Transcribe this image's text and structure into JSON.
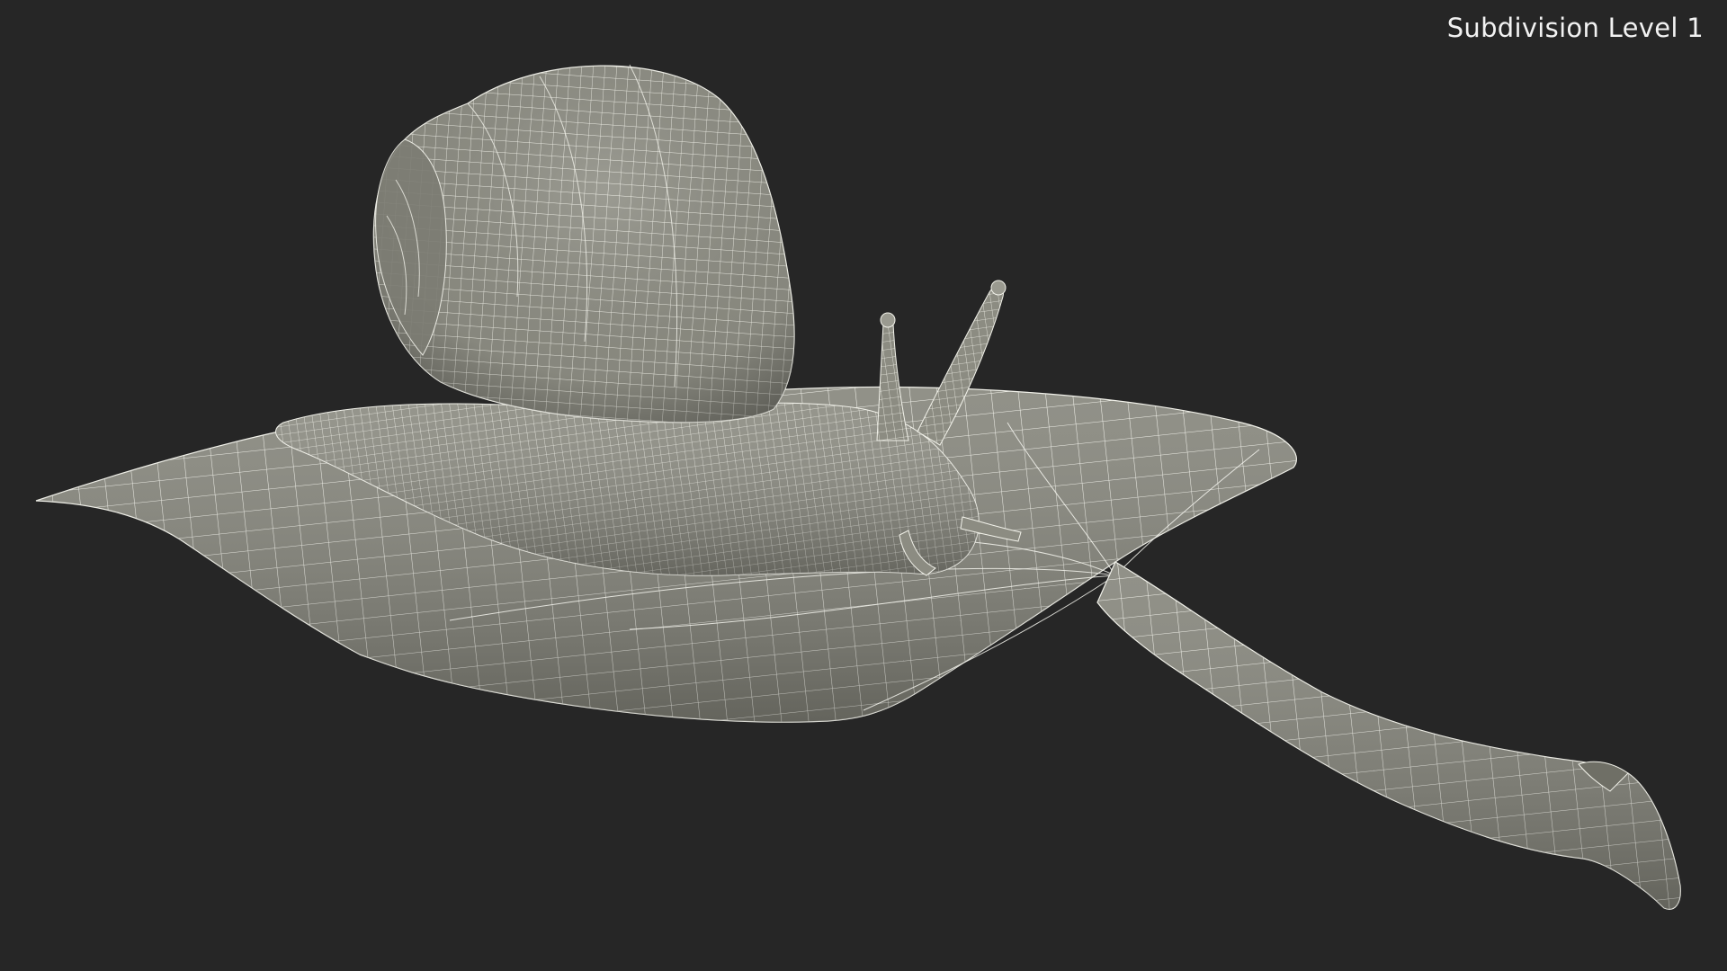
{
  "render": {
    "label": "Subdivision Level 1",
    "background_color": "#262626",
    "surface_color": "#8a8a80",
    "wire_color": "#f4f4ee"
  },
  "scene": {
    "subject": "snail-on-leaf"
  }
}
